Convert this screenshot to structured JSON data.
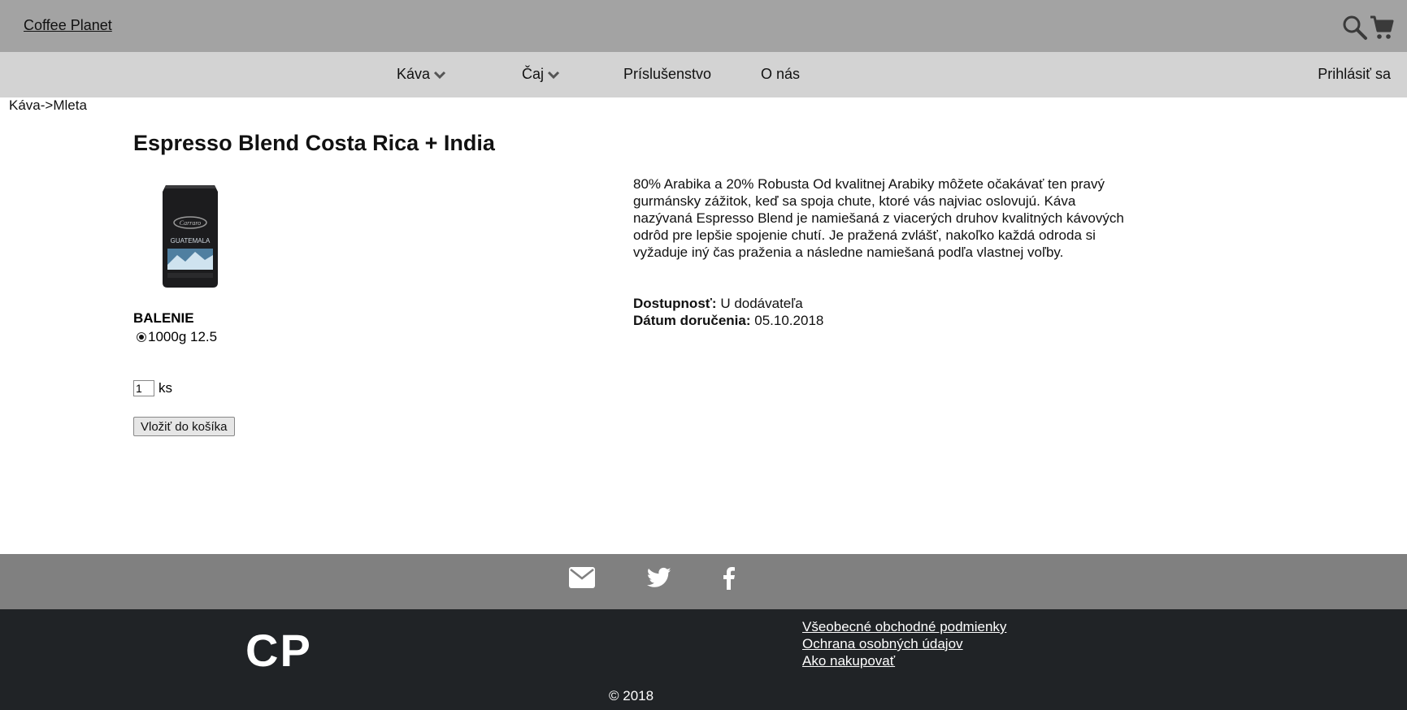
{
  "header": {
    "brand": "Coffee Planet",
    "icons": [
      "search-icon",
      "cart-icon"
    ]
  },
  "nav": {
    "items": [
      {
        "label": "Káva",
        "dropdown": true
      },
      {
        "label": "Čaj",
        "dropdown": true
      },
      {
        "label": "Príslušenstvo",
        "dropdown": false
      },
      {
        "label": "O nás",
        "dropdown": false
      }
    ],
    "login": "Prihlásiť sa"
  },
  "breadcrumb": "Káva->Mleta",
  "product": {
    "title": "Espresso Blend Costa Rica + India",
    "image_label": "GUATEMALA",
    "package_label": "BALENIE",
    "option": "1000g 12.5",
    "quantity": "1",
    "unit": "ks",
    "add_button": "Vložiť do košíka",
    "description": "80% Arabika a 20% Robusta Od kvalitnej Arabiky môžete očakávať ten pravý gurmánsky zážitok, keď sa spoja chute, ktoré vás najviac oslovujú. Káva nazývaná Espresso Blend je namiešaná z viacerých druhov kvalitných kávových odrôd pre lepšie spojenie chutí. Je pražená zvlášť, nakoľko každá odroda si vyžaduje iný čas praženia a následne namiešaná podľa vlastnej voľby.",
    "availability_label": "Dostupnosť:",
    "availability_value": "U dodávateľa",
    "delivery_label": "Dátum doručenia:",
    "delivery_value": "05.10.2018"
  },
  "social": [
    "mail-icon",
    "twitter-icon",
    "facebook-icon"
  ],
  "footer": {
    "logo": "CP",
    "links": [
      "Všeobecné obchodné podmienky",
      "Ochrana osobných údajov",
      "Ako nakupovať"
    ],
    "copyright": "© 2018"
  }
}
